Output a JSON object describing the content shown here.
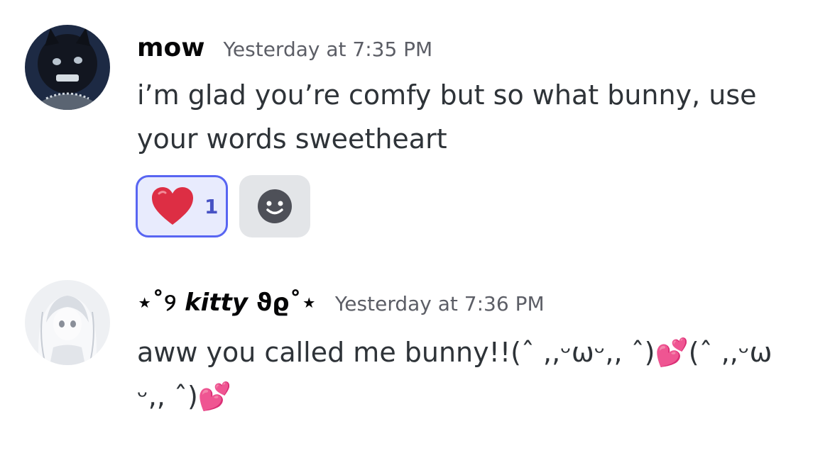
{
  "messages": [
    {
      "username": "mow",
      "timestamp": "Yesterday at 7:35 PM",
      "text": "i’m glad you’re comfy but so what bunny, use your words sweetheart",
      "reactions": [
        {
          "emoji": "red-heart",
          "count": "1",
          "selected": true
        }
      ]
    },
    {
      "username_prefix": "⋆˚୨ ",
      "username_name": "kitty",
      "username_suffix": " ϑϱ˚⋆",
      "timestamp": "Yesterday at 7:36 PM",
      "text_line1": "aww you called me bunny!!(ˆ ,,ᵕωᵕ,, ˆ)💕(ˆ ,,ᵕω",
      "text_line2": "ᵕ,, ˆ)💕"
    }
  ],
  "colors": {
    "accent": "#5865f2",
    "reaction_bg": "#e8ebfd",
    "add_reaction_bg": "#e3e5e8",
    "timestamp": "#5c5e66",
    "text": "#2e3338"
  }
}
